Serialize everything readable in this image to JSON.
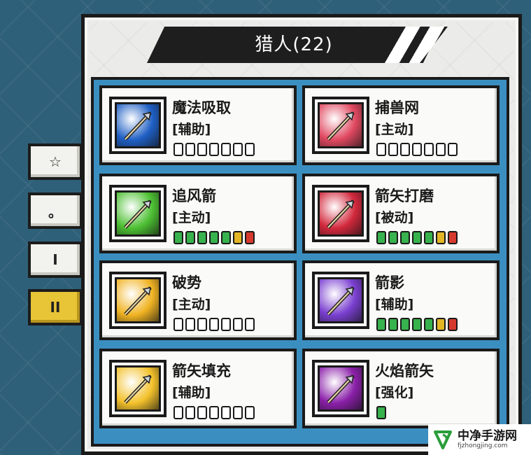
{
  "title": "猎人(22)",
  "side_tabs": [
    {
      "label": "☆",
      "active": false
    },
    {
      "label": "。",
      "active": false
    },
    {
      "label": "I",
      "active": false
    },
    {
      "label": "II",
      "active": true
    }
  ],
  "skills": [
    {
      "name": "魔法吸取",
      "tag": "[辅助]",
      "icon": "magic-orb-icon",
      "level": 0,
      "pips": [
        "e",
        "e",
        "e",
        "e",
        "e",
        "e",
        "e"
      ],
      "icon_color": "#1f5fc4"
    },
    {
      "name": "捕兽网",
      "tag": "[主动]",
      "icon": "net-icon",
      "level": 0,
      "pips": [
        "e",
        "e",
        "e",
        "e",
        "e",
        "e",
        "e"
      ],
      "icon_color": "#e04860"
    },
    {
      "name": "追风箭",
      "tag": "[主动]",
      "icon": "wind-arrow-icon",
      "level": 7,
      "pips": [
        "g",
        "g",
        "g",
        "g",
        "g",
        "y",
        "r"
      ],
      "icon_color": "#4cbf32"
    },
    {
      "name": "箭矢打磨",
      "tag": "[被动]",
      "icon": "arrowhead-icon",
      "level": 7,
      "pips": [
        "g",
        "g",
        "g",
        "g",
        "g",
        "y",
        "r"
      ],
      "icon_color": "#d2283c"
    },
    {
      "name": "破势",
      "tag": "[主动]",
      "icon": "bow-icon",
      "level": 0,
      "pips": [
        "e",
        "e",
        "e",
        "e",
        "e",
        "e",
        "e"
      ],
      "icon_color": "#f0b323"
    },
    {
      "name": "箭影",
      "tag": "[辅助]",
      "icon": "shadow-arrow-icon",
      "level": 7,
      "pips": [
        "g",
        "g",
        "g",
        "g",
        "g",
        "y",
        "r"
      ],
      "icon_color": "#7a3fd0"
    },
    {
      "name": "箭矢填充",
      "tag": "[辅助]",
      "icon": "arrow-fill-icon",
      "level": 0,
      "pips": [
        "e",
        "e",
        "e",
        "e",
        "e",
        "e",
        "e"
      ],
      "icon_color": "#f3c12b"
    },
    {
      "name": "火焰箭矢",
      "tag": "[强化]",
      "icon": "fire-arrow-icon",
      "level": 1,
      "pips": [
        "g"
      ],
      "icon_color": "#8a1fa8"
    }
  ],
  "logo": {
    "cn": "中净手游网",
    "en": "fjzhongjing.com"
  }
}
